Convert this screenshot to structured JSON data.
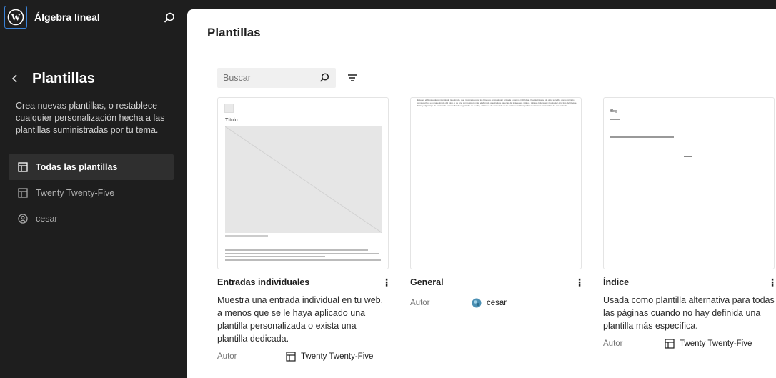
{
  "site": {
    "title": "Álgebra lineal"
  },
  "sidebar": {
    "title": "Plantillas",
    "description": "Crea nuevas plantillas, o restablece cualquier personalización hecha a las plantillas suministradas por tu tema.",
    "items": [
      {
        "label": "Todas las plantillas",
        "icon": "layout-icon",
        "active": true
      },
      {
        "label": "Twenty Twenty-Five",
        "icon": "layout-icon",
        "active": false
      },
      {
        "label": "cesar",
        "icon": "user-icon",
        "active": false
      }
    ]
  },
  "main": {
    "title": "Plantillas",
    "search": {
      "placeholder": "Buscar",
      "value": ""
    }
  },
  "cards": [
    {
      "title": "Entradas individuales",
      "description": "Muestra una entrada individual en tu web, a menos que se le haya aplicado una plantilla personalizada o exista una plantilla dedicada.",
      "author_label": "Autor",
      "author": "Twenty Twenty-Five",
      "author_icon": "layout-icon",
      "preview": {
        "heading": "Título"
      }
    },
    {
      "title": "General",
      "description": "",
      "author_label": "Autor",
      "author": "cesar",
      "author_icon": "avatar",
      "preview": {
        "text": "Este es el bloque de contenido de la entrada, que mostrará todos los bloques en cualquier entrada o página individual. Puede tratarse de algo sencillo, como párrafos consecutivos en una entrada del blog, o de una composición más elaborada que incluye galerías de imágenes, vídeos, tablas, columnas y cualquier otro tipo de bloque. Si hay algún tipo de contenido personalizado registrado en tu sitio, el bloque de contenido de la entrada también podrá mostrar los contenidos de esa entrada."
      }
    },
    {
      "title": "Índice",
      "description": "Usada como plantilla alternativa para todas las páginas cuando no hay definida una plantilla más específica.",
      "author_label": "Autor",
      "author": "Twenty Twenty-Five",
      "author_icon": "layout-icon",
      "preview": {
        "heading": "Blog"
      }
    }
  ],
  "colors": {
    "sidebar_bg": "#1e1e1e",
    "accent": "#3a82d6"
  }
}
